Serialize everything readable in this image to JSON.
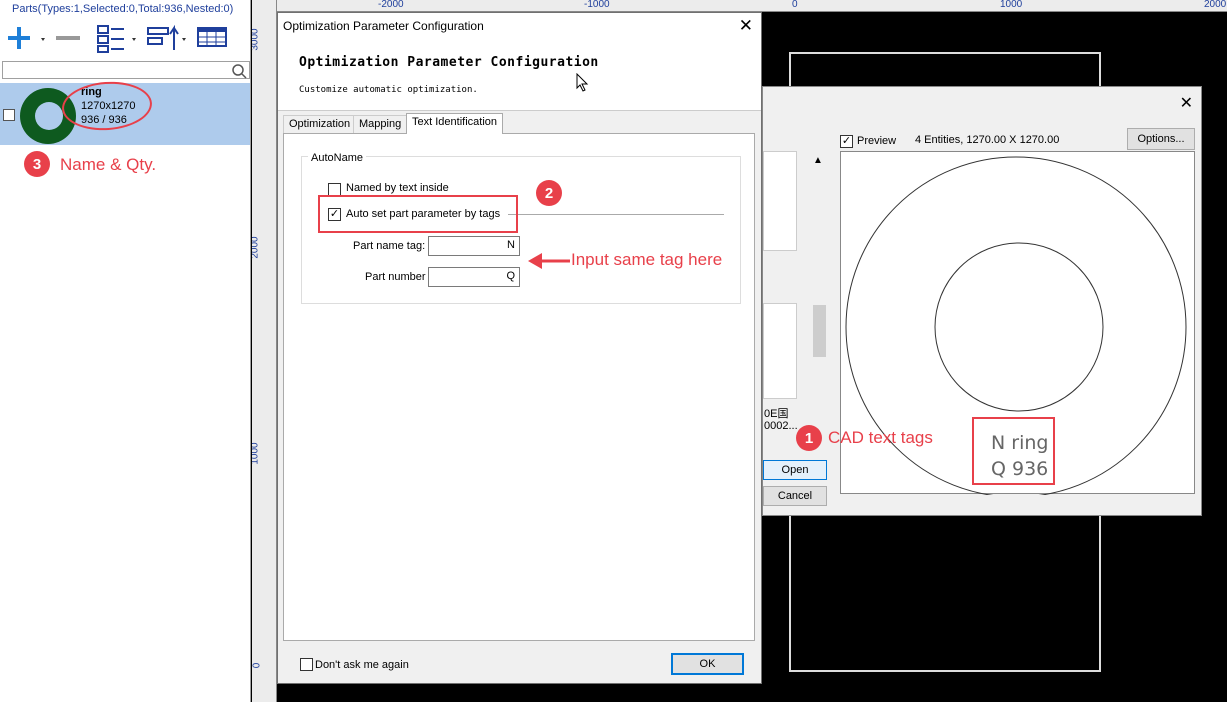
{
  "parts_panel": {
    "title": "Parts(Types:1,Selected:0,Total:936,Nested:0)",
    "search_placeholder": "",
    "part": {
      "name": "ring",
      "size": "1270x1270",
      "qty": "936 / 936"
    }
  },
  "rulers": {
    "top": [
      "-2000",
      "-1000",
      "0",
      "1000",
      "2000"
    ],
    "left": [
      "3000",
      "2000",
      "1000",
      "0"
    ]
  },
  "preview_dialog": {
    "preview_label": "Preview",
    "entities": "4 Entities, 1270.00 X 1270.00",
    "options_label": "Options...",
    "file_label_1": "0E国",
    "file_label_2": "0002...",
    "open_label": "Open",
    "cancel_label": "Cancel",
    "cad_tag_1": "N ring",
    "cad_tag_2": "Q 936"
  },
  "main_dialog": {
    "window_title": "Optimization Parameter Configuration",
    "heading": "Optimization Parameter Configuration",
    "subheading": "Customize automatic optimization.",
    "tabs": [
      "Optimization",
      "Mapping",
      "Text Identification"
    ],
    "group_label": "AutoName",
    "named_by_text_label": "Named by text inside",
    "auto_set_label": "Auto set part parameter by tags",
    "part_name_tag_label": "Part name tag:",
    "part_name_tag_value": "N",
    "part_number_label": "Part number",
    "part_number_value": "Q",
    "dont_ask_label": "Don't ask me again",
    "ok_label": "OK"
  },
  "annotations": {
    "a1_num": "1",
    "a1_text": "CAD text tags",
    "a2_num": "2",
    "a2_text": "Input same tag here",
    "a3_num": "3",
    "a3_text": "Name & Qty."
  }
}
